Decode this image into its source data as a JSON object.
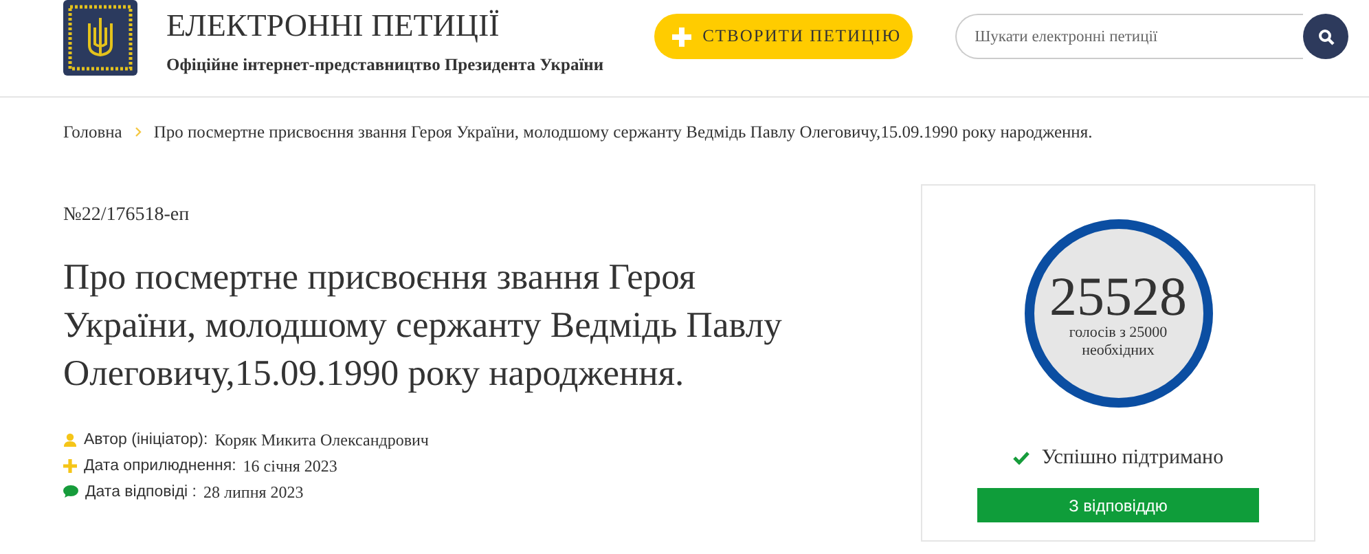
{
  "header": {
    "title": "ЕЛЕКТРОННІ ПЕТИЦІЇ",
    "subtitle": "Офіційне інтернет-представництво Президента України",
    "create_button": "СТВОРИТИ ПЕТИЦІЮ",
    "search": {
      "placeholder": "Шукати електронні петиції"
    }
  },
  "breadcrumb": [
    "Головна",
    "Про посмертне присвоєння звання Героя України, молодшому сержанту Ведмідь Павлу Олеговичу,15.09.1990 року народження."
  ],
  "petition": {
    "number": "№22/176518-еп",
    "title": "Про посмертне присвоєння звання Героя України, молодшому сержанту Ведмідь Павлу Олеговичу,15.09.1990 року народження.",
    "meta": [
      {
        "kind": "author",
        "label": "Автор (ініціатор):",
        "value": "Коряк Микита Олександрович"
      },
      {
        "kind": "published",
        "label": "Дата оприлюднення:",
        "value": "16 січня 2023"
      },
      {
        "kind": "answered",
        "label": "Дата відповіді :",
        "value": "28 липня 2023"
      }
    ]
  },
  "votes": {
    "count": "25528",
    "caption": "голосів з 25000 необхідних",
    "level": 1,
    "status": "Успішно підтримано",
    "answer_button": "З відповіддю"
  }
}
